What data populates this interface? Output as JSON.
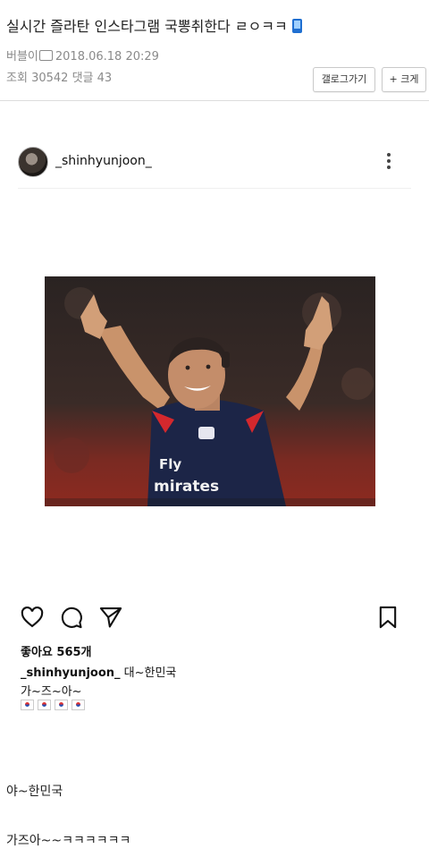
{
  "post": {
    "title": "실시간 즐라탄 인스타그램 국뽕취한다 ㄹㅇㅋㅋ",
    "title_emoji": "mobile-phone-icon",
    "author": "버블이",
    "date": "2018.06.18 20:29",
    "views_label": "조회",
    "views": "30542",
    "comments_label": "댓글",
    "comments": "43",
    "gallery_button": "갤로그가기",
    "enlarge_button": "+ 크게"
  },
  "instagram": {
    "username": "_shinhyunjoon_",
    "photo_jersey_text": [
      "Fly",
      "mirates"
    ],
    "likes": "좋아요 565개",
    "caption_user": "_shinhyunjoon_",
    "caption_text": "대~한민국",
    "caption_line2": "가~즈~아~"
  },
  "body": {
    "line1": "야~한민국",
    "line2": "가즈아~~ㅋㅋㅋㅋㅋㅋ"
  },
  "colors": {
    "meta": "#8a8a8a",
    "divider": "#dcdcdc",
    "jersey": "#1c2547",
    "accent_red": "#d4282d"
  }
}
